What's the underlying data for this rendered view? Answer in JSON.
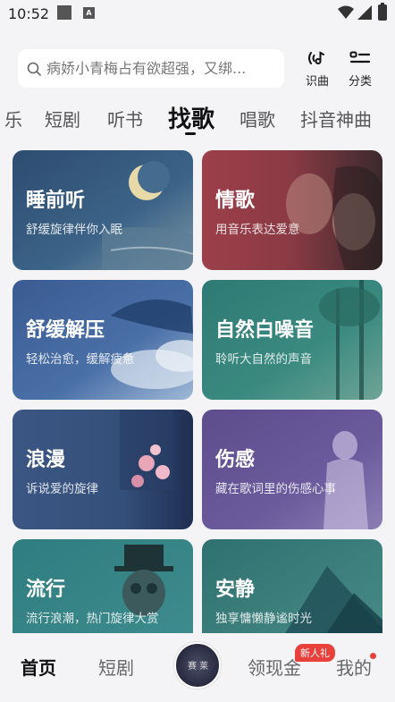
{
  "status_bar": {
    "time": "10:52",
    "notif_letter": "A"
  },
  "search": {
    "placeholder": "病娇小青梅占有欲超强，又绑..."
  },
  "tools": {
    "shazam_label": "识曲",
    "category_label": "分类"
  },
  "tabs": [
    {
      "label": "乐"
    },
    {
      "label": "短剧"
    },
    {
      "label": "听书"
    },
    {
      "label": "找歌"
    },
    {
      "label": "唱歌"
    },
    {
      "label": "抖音神曲"
    }
  ],
  "active_tab": "找歌",
  "cards": [
    {
      "title": "睡前听",
      "subtitle": "舒缓旋律伴你入眠",
      "color": "#35577e"
    },
    {
      "title": "情歌",
      "subtitle": "用音乐表达爱意",
      "color": "#9c3f4a"
    },
    {
      "title": "舒缓解压",
      "subtitle": "轻松治愈，缓解疲惫",
      "color": "#3d5f93"
    },
    {
      "title": "自然白噪音",
      "subtitle": "聆听大自然的声音",
      "color": "#2f7a75"
    },
    {
      "title": "浪漫",
      "subtitle": "诉说爱的旋律",
      "color": "#3b5683"
    },
    {
      "title": "伤感",
      "subtitle": "藏在歌词里的伤感心事",
      "color": "#5e4d8d"
    },
    {
      "title": "流行",
      "subtitle": "流行浪潮，热门旋律大赏",
      "color": "#2f7d80"
    },
    {
      "title": "安静",
      "subtitle": "独享慵懒静谧时光",
      "color": "#2e7170"
    }
  ],
  "bottom_nav": {
    "home": "首页",
    "drama": "短剧",
    "disc_text": "赛 莱",
    "cash": "领现金",
    "cash_badge": "新人礼",
    "mine": "我的"
  }
}
